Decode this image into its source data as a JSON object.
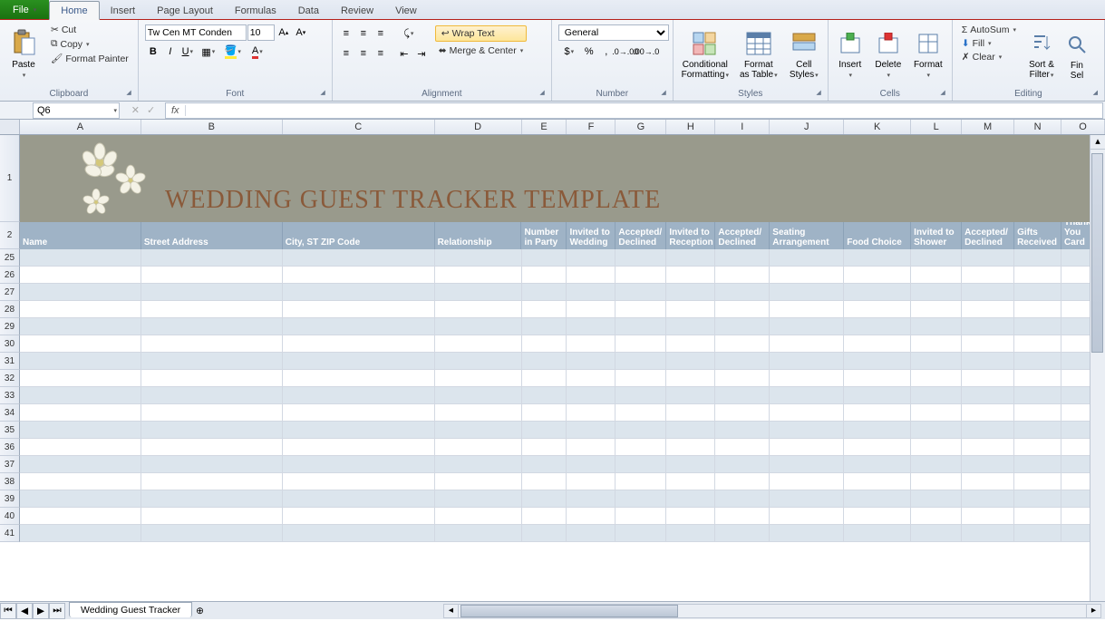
{
  "tabs": {
    "file": "File",
    "home": "Home",
    "insert": "Insert",
    "pageLayout": "Page Layout",
    "formulas": "Formulas",
    "data": "Data",
    "review": "Review",
    "view": "View"
  },
  "clipboard": {
    "paste": "Paste",
    "cut": "Cut",
    "copy": "Copy",
    "formatPainter": "Format Painter",
    "label": "Clipboard"
  },
  "font": {
    "name": "Tw Cen MT Conden",
    "size": "10",
    "label": "Font"
  },
  "alignment": {
    "wrap": "Wrap Text",
    "merge": "Merge & Center",
    "label": "Alignment"
  },
  "number": {
    "format": "General",
    "label": "Number"
  },
  "styles": {
    "cond": "Conditional\nFormatting",
    "table": "Format\nas Table",
    "cell": "Cell\nStyles",
    "label": "Styles"
  },
  "cells": {
    "insert": "Insert",
    "delete": "Delete",
    "format": "Format",
    "label": "Cells"
  },
  "editing": {
    "autosum": "AutoSum",
    "fill": "Fill",
    "clear": "Clear",
    "sort": "Sort &\nFilter",
    "find": "Fin\nSel",
    "label": "Editing"
  },
  "nameBox": "Q6",
  "formulaBar": "",
  "title": "WEDDING GUEST TRACKER TEMPLATE",
  "headers": {
    "A": "Name",
    "B": "Street Address",
    "C": "City, ST  ZIP Code",
    "D": "Relationship",
    "E": "Number in Party",
    "F": "Invited to Wedding",
    "G": "Accepted/ Declined",
    "H": "Invited to Reception",
    "I": "Accepted/ Declined",
    "J": "Seating Arrangement",
    "K": "Food Choice",
    "L": "Invited to Shower",
    "M": "Accepted/ Declined",
    "N": "Gifts Received",
    "O": "Thank You Card"
  },
  "columns": [
    "A",
    "B",
    "C",
    "D",
    "E",
    "F",
    "G",
    "H",
    "I",
    "J",
    "K",
    "L",
    "M",
    "N",
    "O"
  ],
  "dataRows": [
    25,
    26,
    27,
    28,
    29,
    30,
    31,
    32,
    33,
    34,
    35,
    36,
    37,
    38,
    39,
    40,
    41
  ],
  "sheetName": "Wedding Guest Tracker"
}
